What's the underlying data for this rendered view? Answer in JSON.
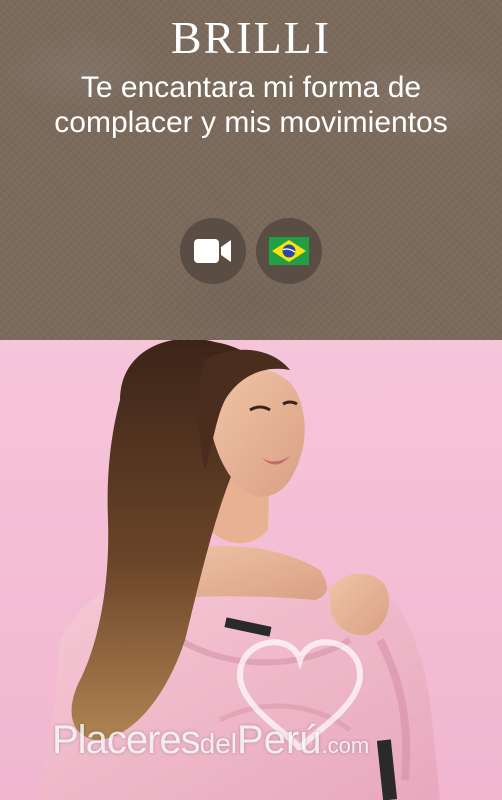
{
  "profile": {
    "name": "BRILLI",
    "tagline": "Te encantara mi forma de complacer y mis movimientos"
  },
  "badges": [
    {
      "icon": "video-camera-icon"
    },
    {
      "icon": "brazil-flag-icon"
    }
  ],
  "watermark": {
    "part1": "Placeres",
    "part2": "del",
    "part3": "Perú",
    "part4": ".com"
  },
  "colors": {
    "header_bg": "#7b6a5c",
    "badge_bg": "#5a4d44",
    "photo_bg": "#f4bfd6"
  }
}
